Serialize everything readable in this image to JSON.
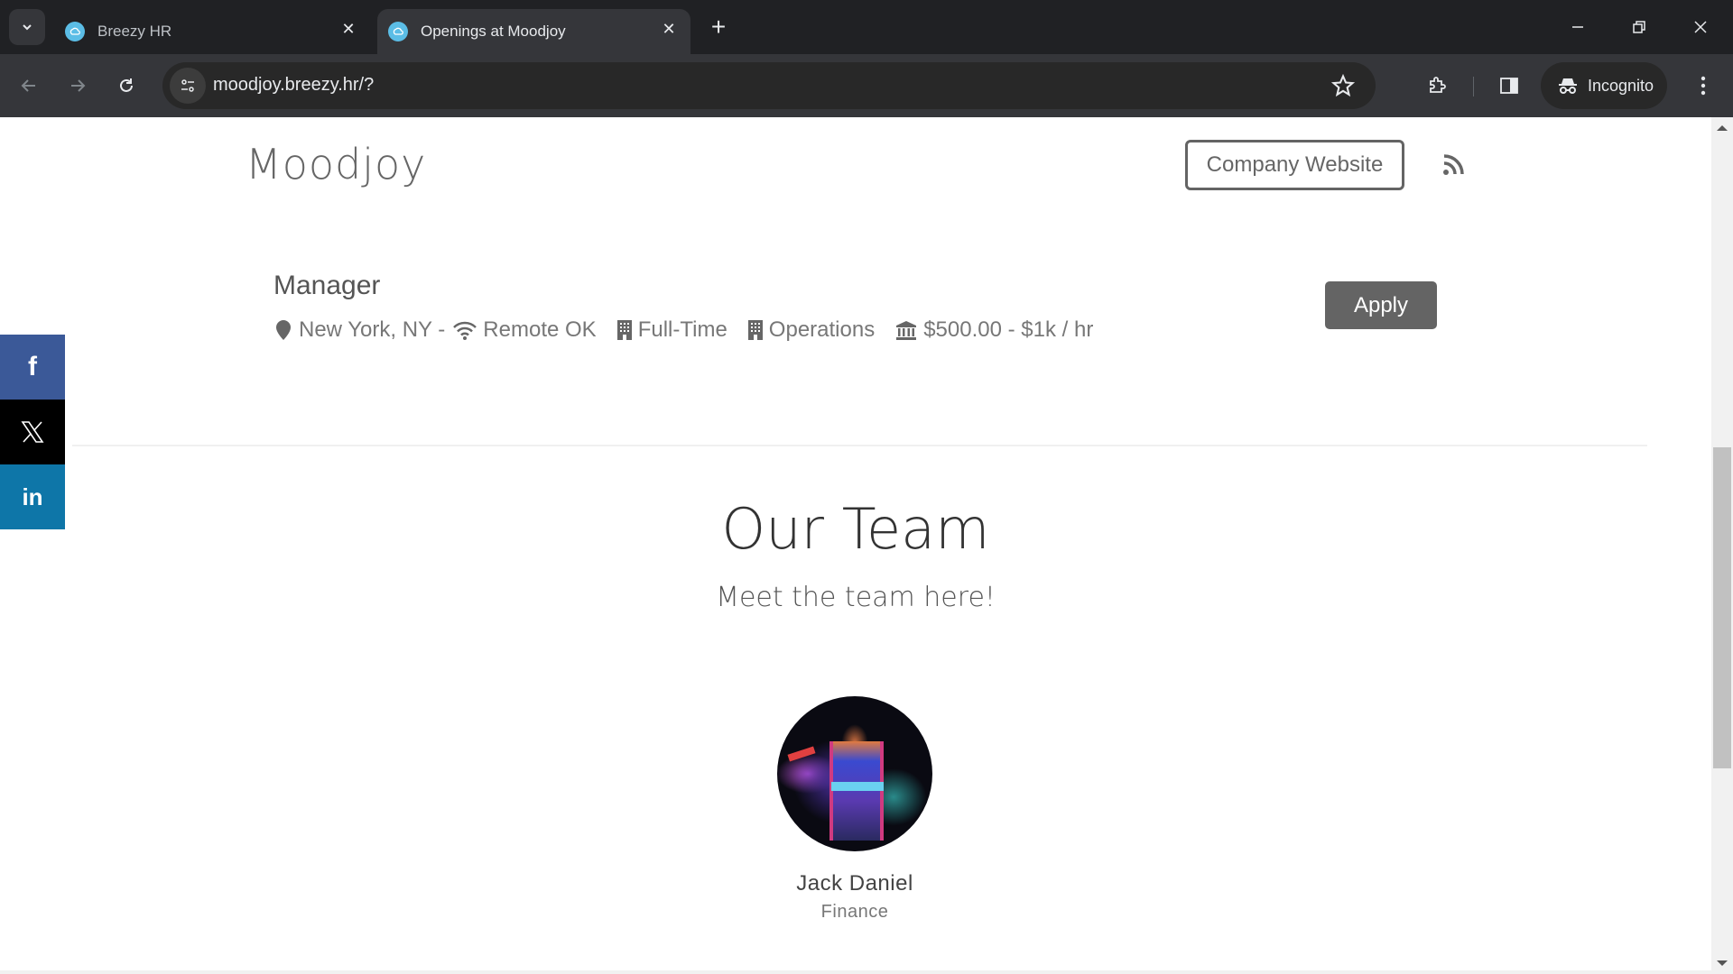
{
  "browser": {
    "tabs": [
      {
        "title": "Breezy HR",
        "active": false
      },
      {
        "title": "Openings at Moodjoy",
        "active": true
      }
    ],
    "url": "moodjoy.breezy.hr/?",
    "profile_label": "Incognito",
    "icons": {
      "tab_search": "chevron-down-icon",
      "favicon": "breezy-cloud-icon",
      "new_tab": "plus-icon",
      "back": "arrow-left-icon",
      "forward": "arrow-right-icon",
      "reload": "reload-icon",
      "site_info": "tune-icon",
      "bookmark": "star-icon",
      "extensions": "puzzle-icon",
      "side_panel": "side-panel-icon",
      "incognito": "incognito-icon",
      "menu": "kebab-menu-icon"
    }
  },
  "header": {
    "brand": "Moodjoy",
    "company_website_label": "Company Website",
    "rss_icon": "rss-icon"
  },
  "job": {
    "title": "Manager",
    "location": "New York, NY -",
    "remote": "Remote OK",
    "type": "Full-Time",
    "department": "Operations",
    "salary": "$500.00 - $1k / hr",
    "apply_label": "Apply"
  },
  "social": [
    {
      "network": "facebook",
      "glyph": "f",
      "color": "#3b5998"
    },
    {
      "network": "x",
      "glyph": "𝕏",
      "color": "#000000"
    },
    {
      "network": "linkedin",
      "glyph": "in",
      "color": "#0e76a8"
    }
  ],
  "team": {
    "title": "Our Team",
    "subtitle": "Meet the team here!",
    "members": [
      {
        "name": "Jack Daniel",
        "department": "Finance"
      }
    ]
  },
  "colors": {
    "button_gray": "#646464",
    "text_gray": "#666666",
    "chrome_dark": "#202124",
    "chrome_toolbar": "#35363a"
  }
}
